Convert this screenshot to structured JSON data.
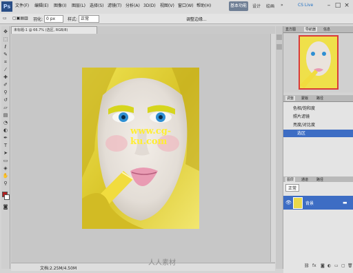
{
  "app": {
    "logo": "Ps"
  },
  "menu": [
    "文件(F)",
    "编辑(E)",
    "图像(I)",
    "图层(L)",
    "选择(S)",
    "滤镜(T)",
    "分析(A)",
    "3D(D)",
    "视图(V)",
    "窗口(W)",
    "帮助(H)"
  ],
  "toolbar_top": {
    "zoom": "100%",
    "workspace_button": "基本功能",
    "workspace_items": [
      "设计",
      "绘画",
      "»",
      "CS Live"
    ]
  },
  "options": {
    "label_feather": "羽化:",
    "feather_value": "0 px",
    "style_label": "样式:",
    "style_value": "正常",
    "refine": "调整边缘..."
  },
  "document": {
    "tab_title": "未标题-1 @ 66.7% (选区, RGB/8)",
    "status": "文档:2.25M/4.50M",
    "watermark_text": "www.cg-ku.com"
  },
  "navigator_panel": {
    "tabs": [
      "直方图",
      "导航器",
      "信息"
    ]
  },
  "adjust_panel": {
    "tabs": [
      "调整",
      "蒙版",
      "路径"
    ],
    "rows": [
      "色相/饱和度",
      "照片滤镜",
      "亮度/对比度",
      "选区"
    ]
  },
  "layers_panel": {
    "tabs": [
      "图层",
      "通道",
      "路径"
    ],
    "blend": "正常",
    "layer_name": "背景"
  },
  "site_watermark": "人人素材",
  "colors": {
    "accent": "#3d6dc4",
    "fg_swatch": "#b32020",
    "bg_swatch": "#ffffff"
  }
}
